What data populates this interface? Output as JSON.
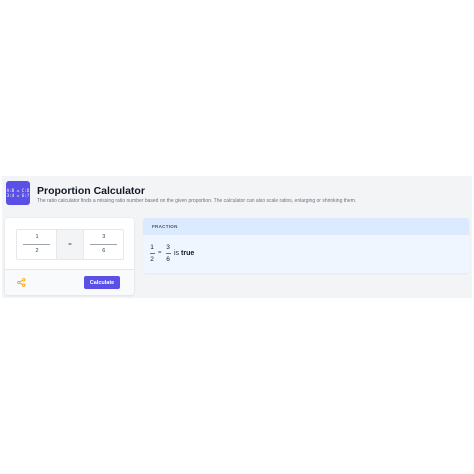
{
  "app": {
    "title": "Proportion Calculator",
    "subtitle": "The ratio calculator finds a missing ratio number based on the given proportion. The calculator can also scale ratios, enlarging or shrinking them.",
    "logo_lines": [
      "A:B = C:D",
      "3:4 = 6:?"
    ]
  },
  "input": {
    "left": {
      "numerator": "1",
      "denominator": "2"
    },
    "operator": "=",
    "right": {
      "numerator": "3",
      "denominator": "6"
    }
  },
  "actions": {
    "calculate_label": "Calculate",
    "share_icon": "share-icon"
  },
  "result": {
    "header": "FRACTION",
    "left": {
      "numerator": "1",
      "denominator": "2"
    },
    "operator": "=",
    "right": {
      "numerator": "3",
      "denominator": "6"
    },
    "verdict_prefix": "is",
    "verdict": "true"
  },
  "colors": {
    "accent": "#5b50e6",
    "share_icon": "#f59e0b",
    "result_bg": "#eff6ff",
    "result_header": "#dbeafe",
    "panel_bg": "#f3f4f6"
  }
}
